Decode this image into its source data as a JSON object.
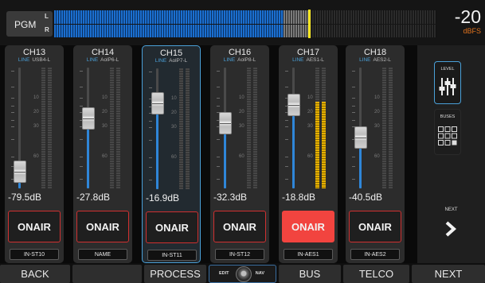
{
  "pgm": {
    "label": "PGM",
    "left_label": "L",
    "right_label": "R",
    "level_value": "-20",
    "level_unit": "dBFS",
    "meter_fill_fraction": 0.6,
    "peak_fraction": 0.665
  },
  "channels": [
    {
      "name": "CH13",
      "src_tag": "LINE",
      "src": "USB4-L",
      "fader_db": "-79.5dB",
      "fader_fraction": 0.06,
      "onair_label": "ONAIR",
      "onair_active": false,
      "route": "IN-ST10",
      "selected": false,
      "meter": 0
    },
    {
      "name": "CH14",
      "src_tag": "LINE",
      "src": "AolP6-L",
      "fader_db": "-27.8dB",
      "fader_fraction": 0.6,
      "onair_label": "ONAIR",
      "onair_active": false,
      "route": "NAME",
      "selected": false,
      "meter": 0
    },
    {
      "name": "CH15",
      "src_tag": "LINE",
      "src": "AolP7-L",
      "fader_db": "-16.9dB",
      "fader_fraction": 0.76,
      "onair_label": "ONAIR",
      "onair_active": false,
      "route": "IN-ST11",
      "selected": true,
      "meter": 0
    },
    {
      "name": "CH16",
      "src_tag": "LINE",
      "src": "AolP8-L",
      "fader_db": "-32.3dB",
      "fader_fraction": 0.55,
      "onair_label": "ONAIR",
      "onair_active": false,
      "route": "IN-ST12",
      "selected": false,
      "meter": 0
    },
    {
      "name": "CH17",
      "src_tag": "LINE",
      "src": "AES1-L",
      "fader_db": "-18.8dB",
      "fader_fraction": 0.73,
      "onair_label": "ONAIR",
      "onair_active": true,
      "route": "IN-AES1",
      "selected": false,
      "meter": 0.72
    },
    {
      "name": "CH18",
      "src_tag": "LINE",
      "src": "AES2-L",
      "fader_db": "-40.5dB",
      "fader_fraction": 0.4,
      "onair_label": "ONAIR",
      "onair_active": false,
      "route": "IN-AES2",
      "selected": false,
      "meter": 0
    }
  ],
  "scale_labels": [
    "10",
    "20",
    "30",
    "60"
  ],
  "side": {
    "level_label": "LEVEL",
    "buses_label": "BUSES",
    "next_label": "NEXT"
  },
  "nav": {
    "back": "BACK",
    "empty": "",
    "process": "PROCESS",
    "edit": "EDIT",
    "nav": "NAV",
    "bus": "BUS",
    "telco": "TELCO",
    "next": "NEXT"
  }
}
